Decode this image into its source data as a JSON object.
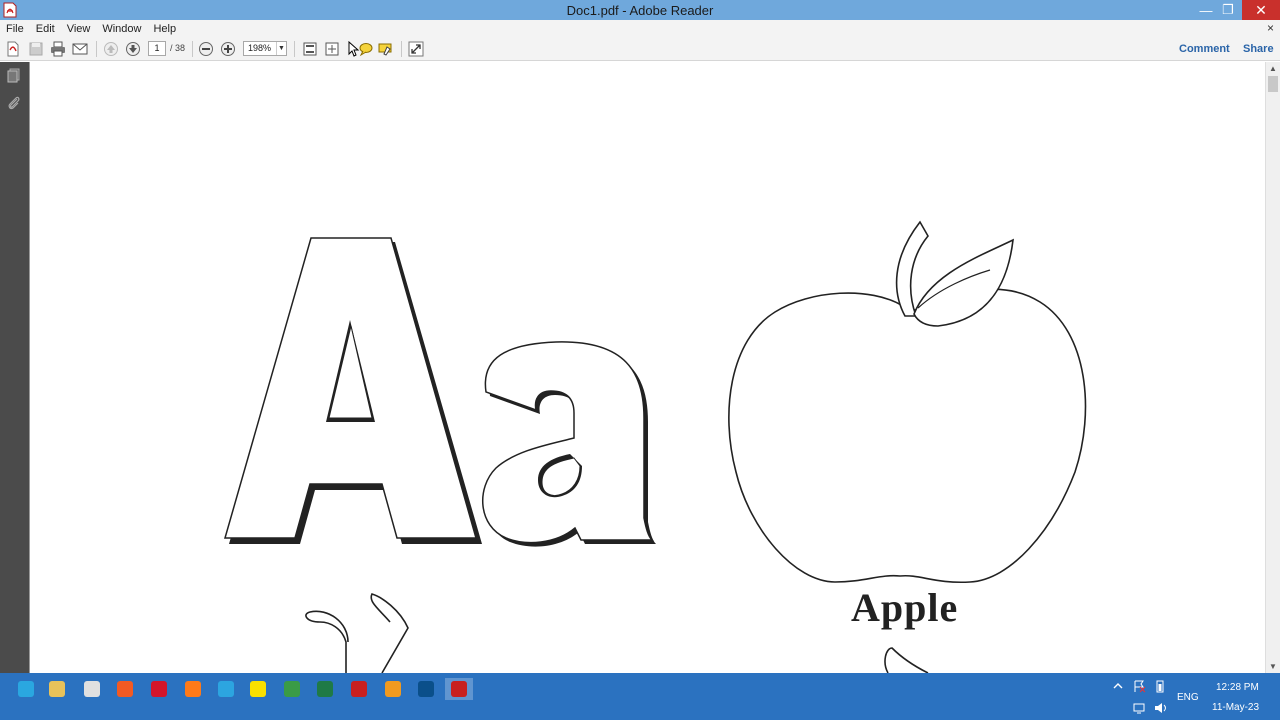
{
  "window": {
    "title": "Doc1.pdf - Adobe Reader",
    "minimize_glyph": "—",
    "maximize_glyph": "❐",
    "close_glyph": "✕"
  },
  "menu": {
    "items": [
      "File",
      "Edit",
      "View",
      "Window",
      "Help"
    ],
    "doc_close_glyph": "×"
  },
  "toolbar": {
    "page_current": "1",
    "page_total": "/ 38",
    "zoom": "198%",
    "comment_label": "Comment",
    "share_label": "Share"
  },
  "document": {
    "letters": "Aa",
    "word": "Apple"
  },
  "taskbar": {
    "language": "ENG",
    "time": "12:28 PM",
    "date": "11-May-23",
    "apps": [
      {
        "name": "internet-explorer-icon",
        "color": "#2aa7e0"
      },
      {
        "name": "file-explorer-icon",
        "color": "#e8c25a"
      },
      {
        "name": "chrome-icon",
        "color": "#e0e0e0"
      },
      {
        "name": "brave-icon",
        "color": "#f25a23"
      },
      {
        "name": "opera-icon",
        "color": "#d4152b"
      },
      {
        "name": "firefox-icon",
        "color": "#ff7a18"
      },
      {
        "name": "telegram-icon",
        "color": "#2ca5e0"
      },
      {
        "name": "kakaotalk-icon",
        "color": "#f9e000"
      },
      {
        "name": "app-icon-green",
        "color": "#3a9b46"
      },
      {
        "name": "excel-icon",
        "color": "#1f7a46"
      },
      {
        "name": "acrobat-dc-icon",
        "color": "#c8201f"
      },
      {
        "name": "app-icon-orange",
        "color": "#f19a1f"
      },
      {
        "name": "photoshop-icon",
        "color": "#0a4f8a"
      },
      {
        "name": "adobe-reader-icon",
        "color": "#c8201f"
      }
    ]
  }
}
